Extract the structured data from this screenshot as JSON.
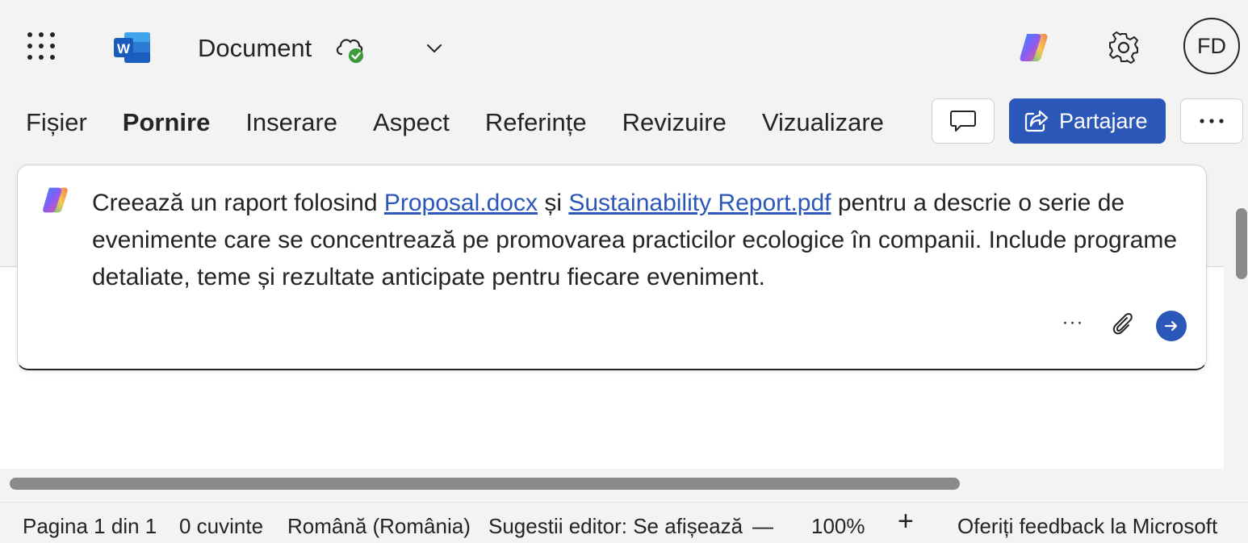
{
  "title_bar": {
    "doc_title": "Document",
    "avatar_initials": "FD",
    "icons": [
      "app-launcher-icon",
      "word-logo-icon",
      "cloud-saved-icon",
      "chevron-down-icon",
      "copilot-icon",
      "gear-icon"
    ]
  },
  "ribbon": {
    "tabs": [
      {
        "label": "Fișier"
      },
      {
        "label": "Pornire"
      },
      {
        "label": "Inserare"
      },
      {
        "label": "Aspect"
      },
      {
        "label": "Referințe"
      },
      {
        "label": "Revizuire"
      },
      {
        "label": "Vizualizare"
      }
    ],
    "active_tab": "Pornire",
    "share_label": "Partajare",
    "accent_color": "#2b57b9"
  },
  "prompt": {
    "text_before": "Creează un raport folosind ",
    "link1": "Proposal.docx",
    "text_mid": " și ",
    "link2": "Sustainability Report.pdf",
    "text_after": " pentru a descrie o serie de evenimente care se concentrează pe promovarea practicilor ecologice în companii. Include programe detaliate, teme și rezultate anticipate pentru fiecare eveniment.",
    "more_label": "···"
  },
  "status_bar": {
    "page": "Pagina 1 din 1",
    "words": "0 cuvinte",
    "language": "Română (România)",
    "editor": "Sugestii editor: Se afișează",
    "zoom_out": "—",
    "zoom": "100%",
    "zoom_in": "+",
    "feedback": "Oferiți feedback la Microsoft"
  }
}
